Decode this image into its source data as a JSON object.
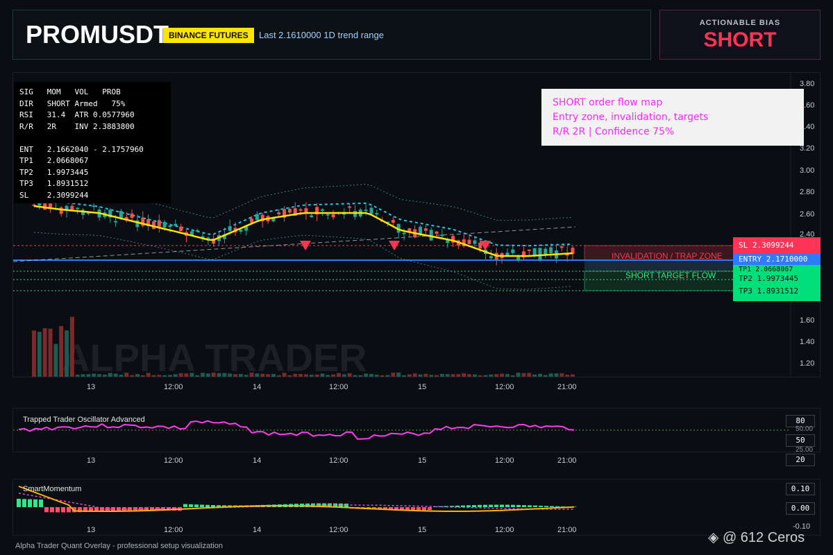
{
  "header": {
    "symbol": "PROMUSDT",
    "exchange_badge": "BINANCE FUTURES",
    "last_label": "Last 2.1610000   1D trend range"
  },
  "bias": {
    "title": "ACTIONABLE BIAS",
    "value": "SHORT"
  },
  "stats": {
    "lines": [
      "SIG   MOM   VOL   PROB",
      "DIR   SHORT Armed   75%",
      "RSI   31.4  ATR 0.0577960",
      "R/R   2R    INV 2.3883800",
      "",
      "ENT   2.1662040 - 2.1757960",
      "TP1   2.0668067",
      "TP2   1.9973445",
      "TP3   1.8931512",
      "SL    2.3099244"
    ]
  },
  "note": {
    "line1": "SHORT order flow map",
    "line2": "Entry zone, invalidation, targets",
    "line3": "R/R 2R | Confidence 75%"
  },
  "price_axis": [
    "3.80",
    "3.60",
    "3.40",
    "3.20",
    "3.00",
    "2.80",
    "2.60",
    "2.40",
    "1.60",
    "1.40",
    "1.20"
  ],
  "time_axis": [
    "13",
    "12:00",
    "14",
    "12:00",
    "15",
    "12:00",
    "21:00"
  ],
  "levels": {
    "sl": "SL 2.3099244",
    "entry": "ENTRY 2.1710000",
    "tp1": "TP1 2.0668067",
    "tp2": "TP2 1.9973445",
    "tp3": "TP3 1.8931512",
    "invalidation_label": "INVALIDATION / TRAP ZONE",
    "target_label": "SHORT TARGET FLOW"
  },
  "watermark": "ALPHA TRADER",
  "oscillator": {
    "title": "Trapped Trader Oscillator Advanced",
    "scale": [
      "80",
      "50.00",
      "50",
      "25.00",
      "20"
    ]
  },
  "momentum": {
    "title": "SmartMomentum",
    "scale": [
      "0.10",
      "0.00",
      "-0.10"
    ]
  },
  "footer": "Alpha Trader Quant Overlay - professional setup visualization",
  "attribution": "@ 612 Ceros",
  "colors": {
    "bull": "#26a69a",
    "bear": "#ef5350",
    "accent": "#ffe400",
    "short": "#ff3355",
    "osc": "#ff3cf0"
  }
}
